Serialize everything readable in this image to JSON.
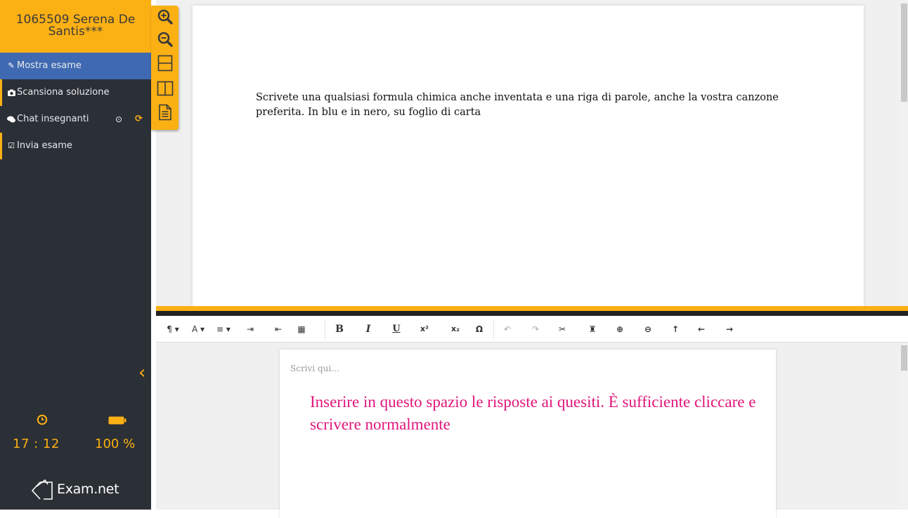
{
  "sidebar": {
    "student_name": "1065509 Serena De Santis***",
    "items": [
      {
        "label": "Mostra esame",
        "icon": "edit-icon"
      },
      {
        "label": "Scansiona soluzione",
        "icon": "camera-icon"
      },
      {
        "label": "Chat insegnanti",
        "icon": "chat-icon"
      },
      {
        "label": "Invia esame",
        "icon": "check-square-icon"
      }
    ],
    "time": "17 : 12",
    "battery": "100 %",
    "logo_text": "Exam.net"
  },
  "tools": [
    "zoom-in-icon",
    "zoom-out-icon",
    "split-horizontal-icon",
    "split-vertical-icon",
    "document-icon"
  ],
  "exam": {
    "question": "Scrivete una qualsiasi formula chimica anche inventata e una riga di parole, anche la vostra canzone preferita. In blu e in nero, su foglio di carta"
  },
  "toolbar": {
    "buttons": [
      {
        "name": "paragraph",
        "label": "¶ ▾"
      },
      {
        "name": "font",
        "label": "A ▾"
      },
      {
        "name": "align",
        "label": "≡ ▾"
      },
      {
        "name": "indent",
        "label": "⇥"
      },
      {
        "name": "outdent",
        "label": "⇤"
      },
      {
        "name": "table",
        "label": "▦"
      },
      {
        "name": "bold",
        "label": "B"
      },
      {
        "name": "italic",
        "label": "I"
      },
      {
        "name": "underline",
        "label": "U"
      },
      {
        "name": "superscript",
        "label": "x²"
      },
      {
        "name": "subscript",
        "label": "x₂"
      },
      {
        "name": "special-chars",
        "label": "Ω"
      },
      {
        "name": "undo",
        "label": "↶"
      },
      {
        "name": "redo",
        "label": "↷"
      },
      {
        "name": "cut",
        "label": "✂"
      },
      {
        "name": "plugin",
        "label": "♜"
      },
      {
        "name": "zoom-in",
        "label": "⊕"
      },
      {
        "name": "zoom-out",
        "label": "⊖"
      },
      {
        "name": "arrow-up",
        "label": "↑"
      },
      {
        "name": "arrow-left",
        "label": "←"
      },
      {
        "name": "arrow-right",
        "label": "→"
      }
    ]
  },
  "editor": {
    "placeholder": "Scrivi qui...",
    "instruction": "Inserire in questo spazio le risposte ai quesiti. È sufficiente cliccare e scrivere normalmente"
  },
  "colors": {
    "accent": "#fbb014",
    "sidebar_bg": "#2b2f36",
    "active_item": "#3f6ab1",
    "instruction_text": "#e0157a"
  }
}
